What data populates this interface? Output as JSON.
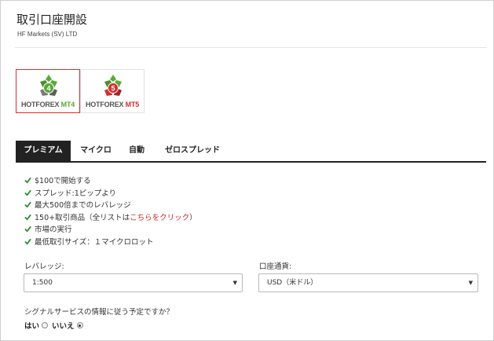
{
  "header": {
    "title": "取引口座開設",
    "subtitle": "HF Markets (SV) LTD"
  },
  "platforms": [
    {
      "brand": "HOTFOREX",
      "version": "MT4",
      "badge": "4",
      "selected": true,
      "color": "#5aa837"
    },
    {
      "brand": "HOTFOREX",
      "version": "MT5",
      "badge": "5",
      "selected": false,
      "color": "#d32f2f"
    }
  ],
  "tabs": [
    {
      "label": "プレミアム",
      "active": true
    },
    {
      "label": "マイクロ",
      "active": false
    },
    {
      "label": "自動",
      "active": false
    },
    {
      "label": "ゼロスプレッド",
      "active": false
    }
  ],
  "features": {
    "items": [
      "$100で開始する",
      "スプレッド:1ピップより",
      "最大500倍までのレバレッジ",
      "150+取引商品（全リストは",
      "市場の実行",
      "最低取引サイズ：１マイクロロット"
    ],
    "link_text": "こちらをクリック",
    "link_suffix": "）",
    "check_color": "#2e8b2e"
  },
  "form": {
    "leverage_label": "レバレッジ:",
    "leverage_value": "1:500",
    "currency_label": "口座通貨:",
    "currency_value": "USD（米ドル）",
    "arrow_icon": "▼"
  },
  "signal": {
    "question": "シグナルサービスの情報に従う予定ですか？",
    "yes_label": "はい",
    "no_label": "いいえ",
    "selected": "no"
  },
  "colors": {
    "accent_red": "#d32f2f",
    "tab_active_bg": "#222222"
  }
}
